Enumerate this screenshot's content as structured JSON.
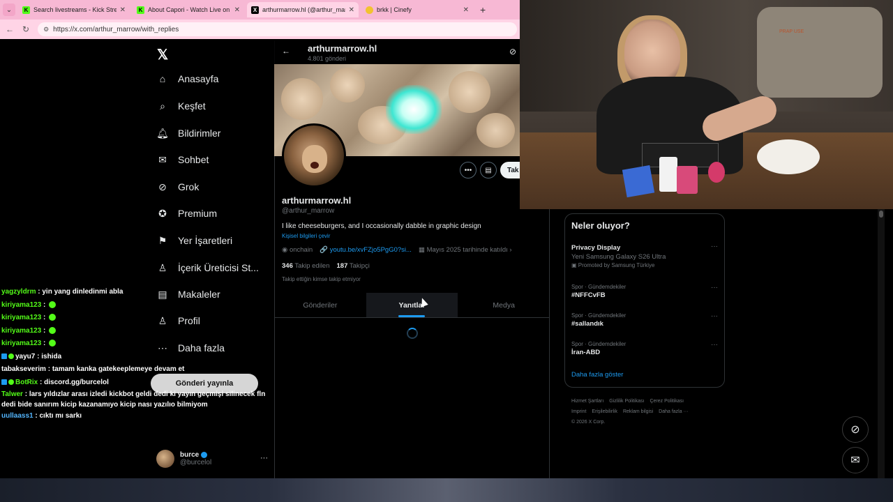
{
  "browser": {
    "tabs": [
      {
        "title": "Search livestreams - Kick Stream",
        "icon": "kick-icon",
        "active": false
      },
      {
        "title": "About Capori - Watch Live on Kick",
        "icon": "kick-icon",
        "active": false
      },
      {
        "title": "arthurmarrow.hl (@arthur_marrow)",
        "icon": "x-icon",
        "active": true
      },
      {
        "title": "brkk | Cinefy",
        "icon": "cinefy-icon",
        "active": false
      }
    ],
    "new_tab": "+",
    "url": "https://x.com/arthur_marrow/with_replies"
  },
  "nav": {
    "items": [
      {
        "label": "Anasayfa",
        "icon": "home-icon"
      },
      {
        "label": "Keşfet",
        "icon": "search-icon"
      },
      {
        "label": "Bildirimler",
        "icon": "bell-icon"
      },
      {
        "label": "Sohbet",
        "icon": "mail-icon"
      },
      {
        "label": "Grok",
        "icon": "grok-icon"
      },
      {
        "label": "Premium",
        "icon": "premium-icon"
      },
      {
        "label": "Yer İşaretleri",
        "icon": "bookmark-icon"
      },
      {
        "label": "İçerik Üreticisi St...",
        "icon": "creator-icon"
      },
      {
        "label": "Makaleler",
        "icon": "article-icon"
      },
      {
        "label": "Profil",
        "icon": "person-icon"
      },
      {
        "label": "Daha fazla",
        "icon": "more-circle-icon"
      }
    ],
    "post_button": "Gönderi yayınla",
    "account": {
      "name": "burce",
      "handle": "@burcelol",
      "more": "···"
    }
  },
  "chat": [
    {
      "user": "yagzyldrm",
      "text": "yin yang dinledinmi abla",
      "color": "#53fc18"
    },
    {
      "user": "kiriyama123",
      "text": "",
      "color": "#53fc18",
      "emote": true
    },
    {
      "user": "kiriyama123",
      "text": "",
      "color": "#53fc18",
      "emote": true
    },
    {
      "user": "kiriyama123",
      "text": "",
      "color": "#53fc18",
      "emote": true
    },
    {
      "user": "kiriyama123",
      "text": "",
      "color": "#53fc18",
      "emote": true
    },
    {
      "user": "yayu7",
      "text": "ishida",
      "color": "#ffffff",
      "badges": true
    },
    {
      "user": "tabakseverim",
      "text": "tamam kanka gatekeeplemeye devam et",
      "color": "#ffffff"
    },
    {
      "user": "BotRix",
      "text": "discord.gg/burcelol",
      "color": "#53fc18",
      "badges": true
    },
    {
      "user": "Talwer",
      "text": "lars yıldızlar arası izledi kickbot geldi dedi ki yayın geçmişi silinecek fln dedi bide sanırım kicip kazanamıyo kicip nası yazılıo bilmiyom",
      "color": "#53fc18"
    },
    {
      "user": "uullaass1",
      "text": "cıktı mı sarkı",
      "color": "#53b4fc"
    }
  ],
  "profile": {
    "header_name": "arthurmarrow.hl",
    "post_count": "4.801 gönderi",
    "display_name": "arthurmarrow.hl",
    "handle": "@arthur_marrow",
    "bio": "I like cheeseburgers, and I occasionally dabble in graphic design",
    "translate": "Kişisel bilgileri çevir",
    "location": "onchain",
    "link": "youtu.be/xvFZjo5PgG0?si...",
    "joined": "Mayıs 2025 tarihinde katıldı",
    "following_count": "346",
    "following_label": "Takip edilen",
    "followers_count": "187",
    "followers_label": "Takipçi",
    "no_mutual": "Takip ettiğin kimse takip etmiyor",
    "follow_button": "Tak",
    "tabs": [
      "Gönderiler",
      "Yanıtlar",
      "Medya"
    ],
    "active_tab": 1
  },
  "cam_label": "PRAP USE",
  "trends": {
    "title": "Neler oluyor?",
    "items": [
      {
        "category": "",
        "name": "Privacy Display",
        "sub": "Yeni Samsung Galaxy S26 Ultra",
        "promo": "Promoted by Samsung Türkiye"
      },
      {
        "category": "Spor · Gündemdekiler",
        "name": "#NFFCvFB"
      },
      {
        "category": "Spor · Gündemdekiler",
        "name": "#sallandık"
      },
      {
        "category": "Spor · Gündemdekiler",
        "name": "İran-ABD"
      }
    ],
    "show_more": "Daha fazla göster",
    "footer": [
      "Hizmet Şartları",
      "Gizlilik Politikası",
      "Çerez Politikası",
      "Imprint",
      "Erişilebilirlik",
      "Reklam bilgisi",
      "Daha fazla ···",
      "© 2026 X Corp."
    ]
  }
}
